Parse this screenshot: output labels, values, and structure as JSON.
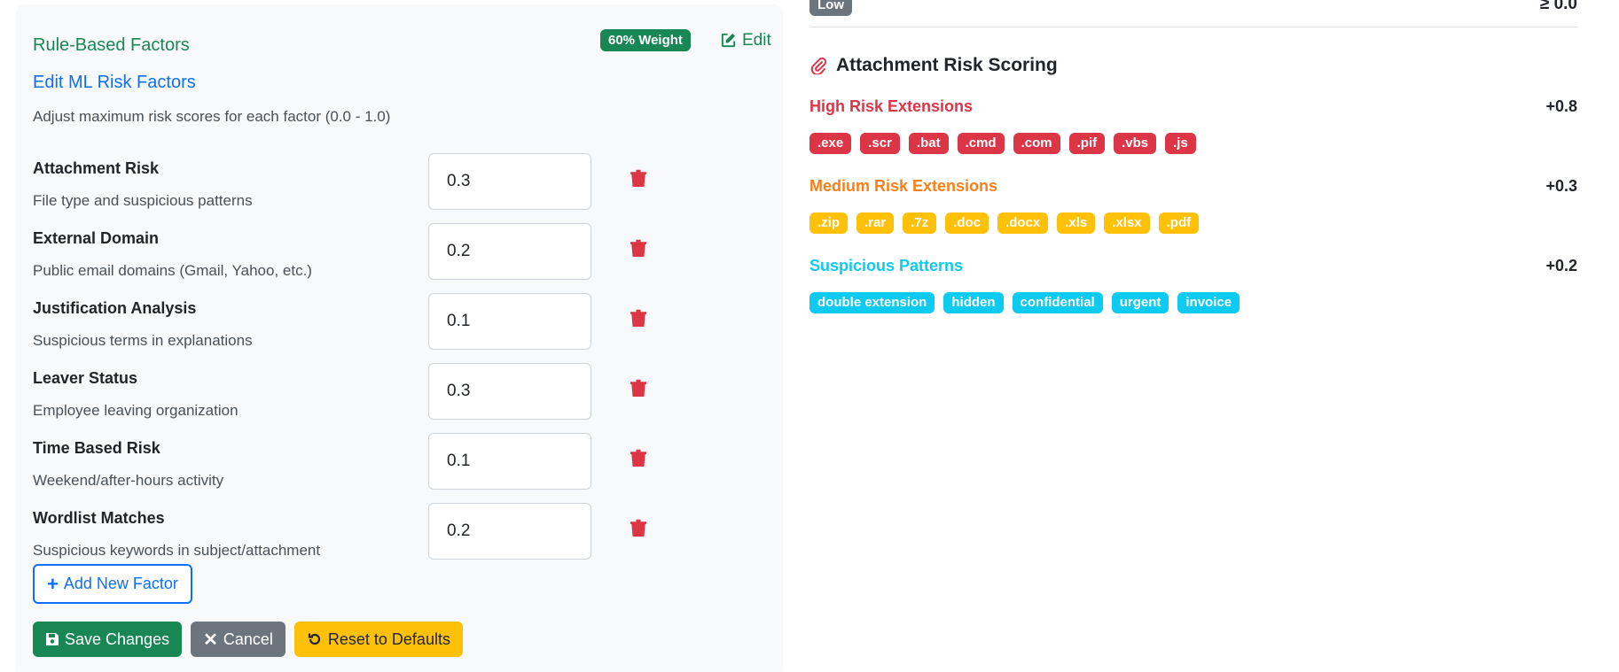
{
  "rule_based": {
    "title": "Rule-Based Factors",
    "weight_badge": "60% Weight",
    "edit_label": "Edit"
  },
  "ml": {
    "title": "Edit ML Risk Factors",
    "description": "Adjust maximum risk scores for each factor (0.0 - 1.0)"
  },
  "factors": [
    {
      "name": "Attachment Risk",
      "desc": "File type and suspicious patterns",
      "value": "0.3"
    },
    {
      "name": "External Domain",
      "desc": "Public email domains (Gmail, Yahoo, etc.)",
      "value": "0.2"
    },
    {
      "name": "Justification Analysis",
      "desc": "Suspicious terms in explanations",
      "value": "0.1"
    },
    {
      "name": "Leaver Status",
      "desc": "Employee leaving organization",
      "value": "0.3"
    },
    {
      "name": "Time Based Risk",
      "desc": "Weekend/after-hours activity",
      "value": "0.1"
    },
    {
      "name": "Wordlist Matches",
      "desc": "Suspicious keywords in subject/attachment",
      "value": "0.2"
    }
  ],
  "buttons": {
    "add_factor": "Add New Factor",
    "save": "Save Changes",
    "cancel": "Cancel",
    "reset": "Reset to Defaults"
  },
  "threshold": {
    "badge": "Low",
    "value": "≥ 0.0"
  },
  "attachment": {
    "title": "Attachment Risk Scoring",
    "categories": [
      {
        "label": "High Risk Extensions",
        "value": "+0.8",
        "color": "#dc3545",
        "chips": [
          ".exe",
          ".scr",
          ".bat",
          ".cmd",
          ".com",
          ".pif",
          ".vbs",
          ".js"
        ]
      },
      {
        "label": "Medium Risk Extensions",
        "value": "+0.3",
        "color": "#fd7e14",
        "chips": [
          ".zip",
          ".rar",
          ".7z",
          ".doc",
          ".docx",
          ".xls",
          ".xlsx",
          ".pdf"
        ]
      },
      {
        "label": "Suspicious Patterns",
        "value": "+0.2",
        "color": "#0dcaf0",
        "chips": [
          "double extension",
          "hidden",
          "confidential",
          "urgent",
          "invoice"
        ]
      }
    ]
  },
  "colors": {
    "success": "#198754",
    "primary": "#0d6efd",
    "danger": "#dc3545",
    "warning": "#ffc107",
    "secondary": "#6c757d",
    "info": "#0dcaf0"
  },
  "icons": [
    "edit-icon",
    "trash-icon",
    "plus-icon",
    "save-icon",
    "x-icon",
    "reset-icon",
    "paperclip-icon"
  ]
}
